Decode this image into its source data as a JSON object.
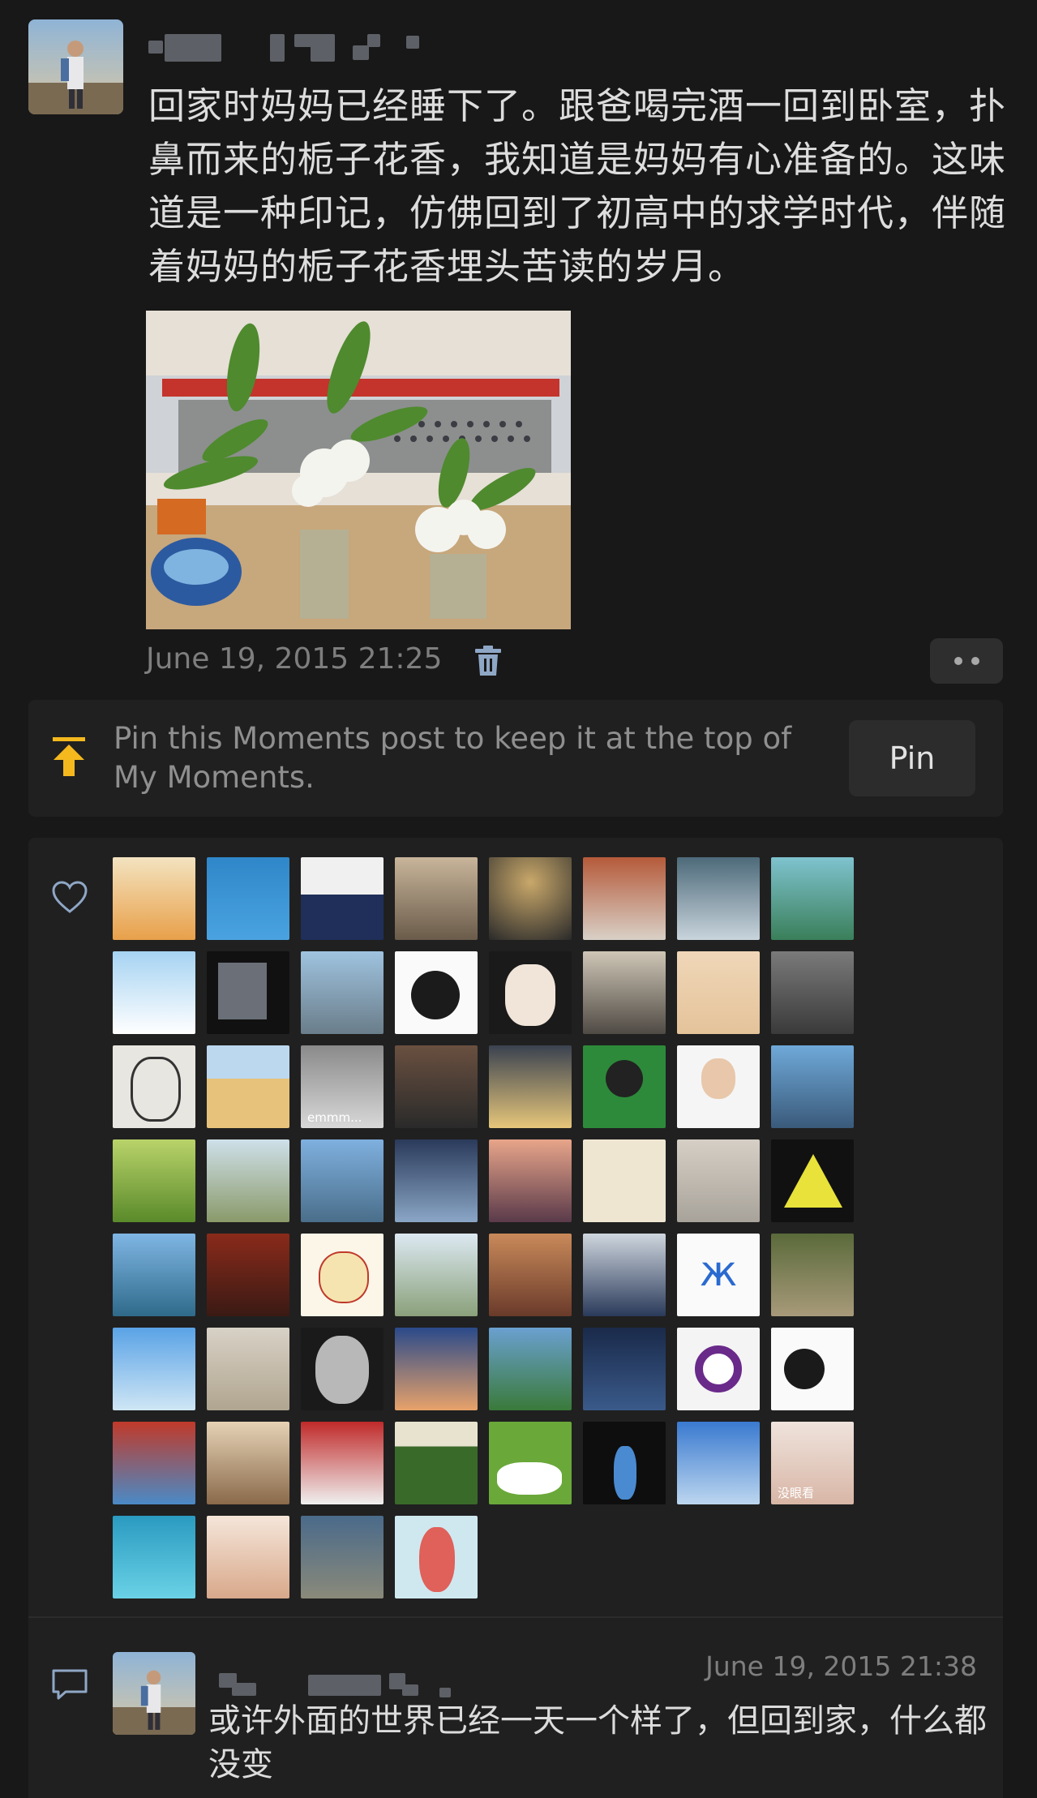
{
  "post": {
    "text": "回家时妈妈已经睡下了。跟爸喝完酒一回到卧室，扑鼻而来的栀子花香，我知道是妈妈有心准备的。这味道是一种印记，仿佛回到了初高中的求学时代，伴随着妈妈的栀子花香埋头苦读的岁月。",
    "timestamp": "June 19, 2015 21:25"
  },
  "pin": {
    "text": "Pin this Moments post to keep it at the top of My Moments.",
    "button_label": "Pin"
  },
  "likes": {
    "avatar_labels": [
      "emmm...",
      "没眼看"
    ]
  },
  "comment": {
    "timestamp": "June 19, 2015 21:38",
    "text": "或许外面的世界已经一天一个样了，但回到家，什么都没变"
  },
  "colors": {
    "background": "#181818",
    "panel": "#202020",
    "accent_pin": "#f5b91e"
  },
  "icons": [
    "trash-icon",
    "more-icon",
    "pin-top-icon",
    "heart-icon",
    "comment-icon"
  ]
}
